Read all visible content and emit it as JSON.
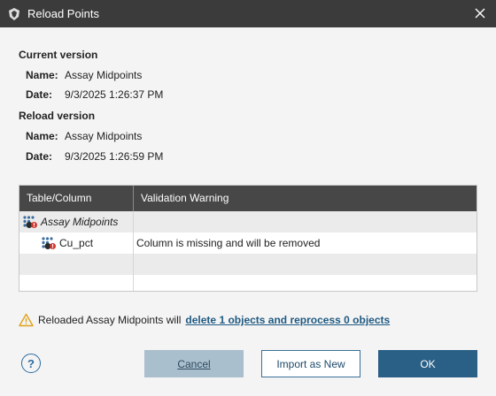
{
  "window": {
    "title": "Reload Points",
    "icon": "leapfrog-app-icon"
  },
  "current_version": {
    "heading": "Current version",
    "name_label": "Name:",
    "name_value": "Assay Midpoints",
    "date_label": "Date:",
    "date_value": "9/3/2025 1:26:37 PM"
  },
  "reload_version": {
    "heading": "Reload version",
    "name_label": "Name:",
    "name_value": "Assay Midpoints",
    "date_label": "Date:",
    "date_value": "9/3/2025 1:26:59 PM"
  },
  "table": {
    "columns": [
      "Table/Column",
      "Validation Warning"
    ],
    "rows": [
      {
        "name": "Assay Midpoints",
        "warning": "",
        "italic": true
      },
      {
        "name": "Cu_pct",
        "warning": "Column is missing and will be removed",
        "italic": false
      }
    ]
  },
  "warning": {
    "text": "Reloaded Assay Midpoints will",
    "link": "delete 1 objects and reprocess 0 objects"
  },
  "buttons": {
    "help": "?",
    "cancel": "Cancel",
    "import": "Import as New",
    "ok": "OK"
  },
  "colors": {
    "titlebar": "#3b3b3b",
    "table_header": "#474747",
    "primary": "#2a5f86",
    "link": "#1f5a82"
  }
}
